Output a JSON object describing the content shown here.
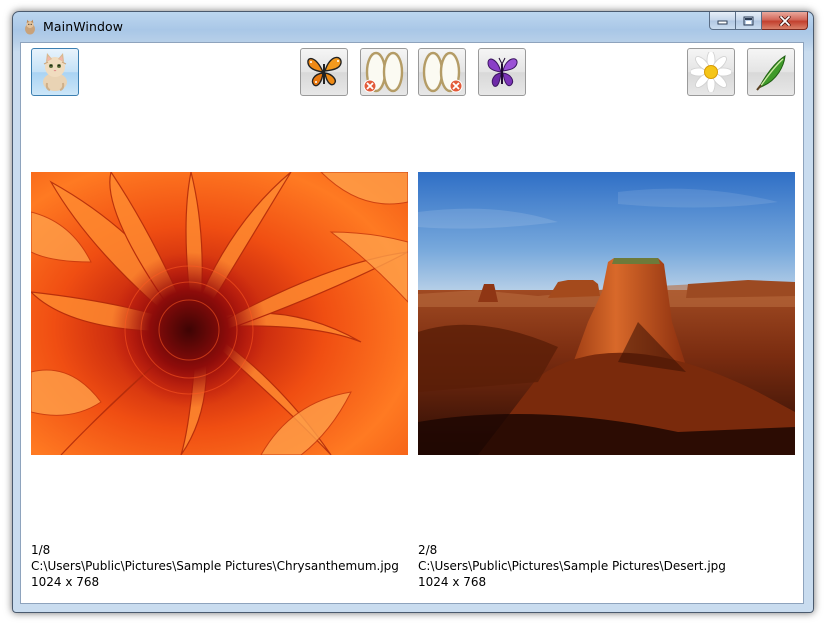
{
  "window": {
    "title": "MainWindow"
  },
  "toolbar": {
    "buttons": [
      {
        "name": "cat-icon"
      },
      {
        "name": "butterfly-icon"
      },
      {
        "name": "mirror-left-icon"
      },
      {
        "name": "mirror-right-icon"
      },
      {
        "name": "purple-butterfly-icon"
      },
      {
        "name": "daisy-icon"
      },
      {
        "name": "feather-icon"
      }
    ]
  },
  "images": [
    {
      "index": "1/8",
      "path": "C:\\Users\\Public\\Pictures\\Sample Pictures\\Chrysanthemum.jpg",
      "size": "1024 x 768"
    },
    {
      "index": "2/8",
      "path": "C:\\Users\\Public\\Pictures\\Sample Pictures\\Desert.jpg",
      "size": "1024 x 768"
    }
  ]
}
